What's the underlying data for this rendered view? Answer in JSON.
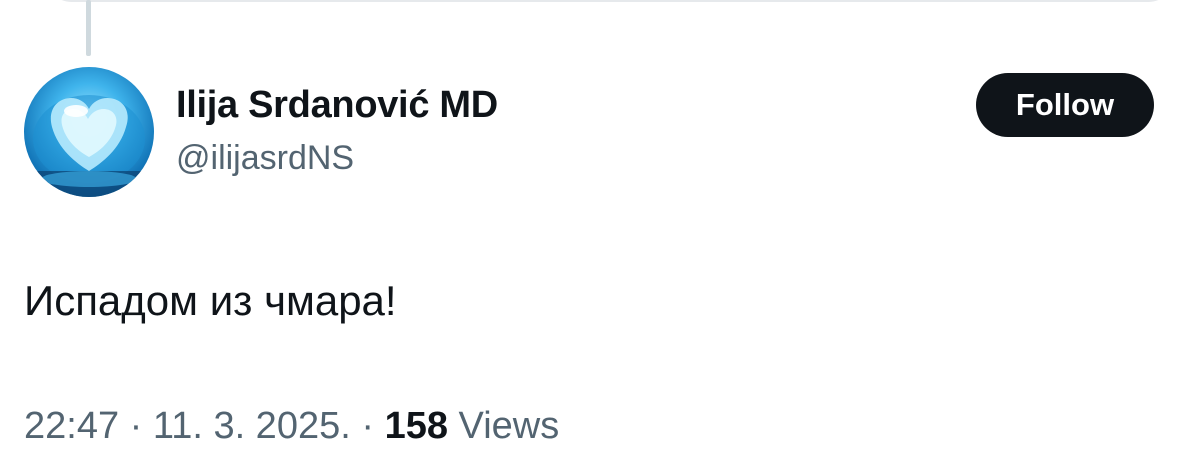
{
  "author": {
    "display_name": "Ilija Srdanović MD",
    "handle": "@ilijasrdNS"
  },
  "follow_button": {
    "label": "Follow"
  },
  "tweet": {
    "text": "Испадом из чмара!"
  },
  "meta": {
    "time": "22:47",
    "separator": " · ",
    "date": "11. 3. 2025.",
    "views_count": "158",
    "views_label": "Views"
  },
  "colors": {
    "text_primary": "#0f1419",
    "text_secondary": "#536471",
    "button_background": "#0f1419",
    "button_text": "#ffffff",
    "thread_line": "#cfd9de"
  },
  "icons": {
    "avatar": "blue-ice-heart-avatar"
  }
}
